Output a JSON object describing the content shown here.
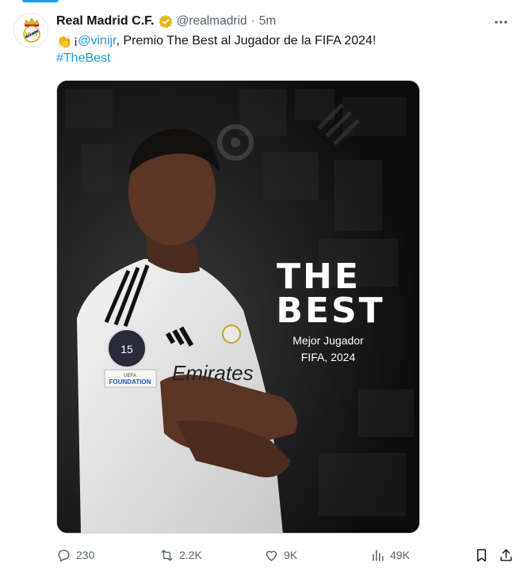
{
  "tweet": {
    "display_name": "Real Madrid C.F.",
    "handle": "@realmadrid",
    "separator": "·",
    "time": "5m",
    "text": {
      "clap_emoji": "👏",
      "prefix": "¡",
      "mention": "@vinijr",
      "rest": ", Premio The Best al Jugador de la FIFA 2024!",
      "hashtag": "#TheBest"
    },
    "media": {
      "title_line1": "THE",
      "title_line2": "BEST",
      "subtitle_line1": "Mejor Jugador",
      "subtitle_line2": "FIFA, 2024",
      "shirt_sponsor": "Emirates",
      "badge_number": "15",
      "patch_line1": "UEFA",
      "patch_line2": "FOUNDATION"
    },
    "actions": {
      "replies": "230",
      "reposts": "2.2K",
      "likes": "9K",
      "views": "49K"
    }
  },
  "icons": {
    "verified": "verified-gold-badge-icon",
    "more": "more-horizontal-icon",
    "reply": "reply-icon",
    "repost": "repost-icon",
    "like": "heart-icon",
    "views": "analytics-icon",
    "bookmark": "bookmark-icon",
    "share": "share-icon"
  },
  "colors": {
    "accent": "#1d9bf0",
    "secondary_text": "#536471",
    "verified_gold": "#e2b719"
  }
}
